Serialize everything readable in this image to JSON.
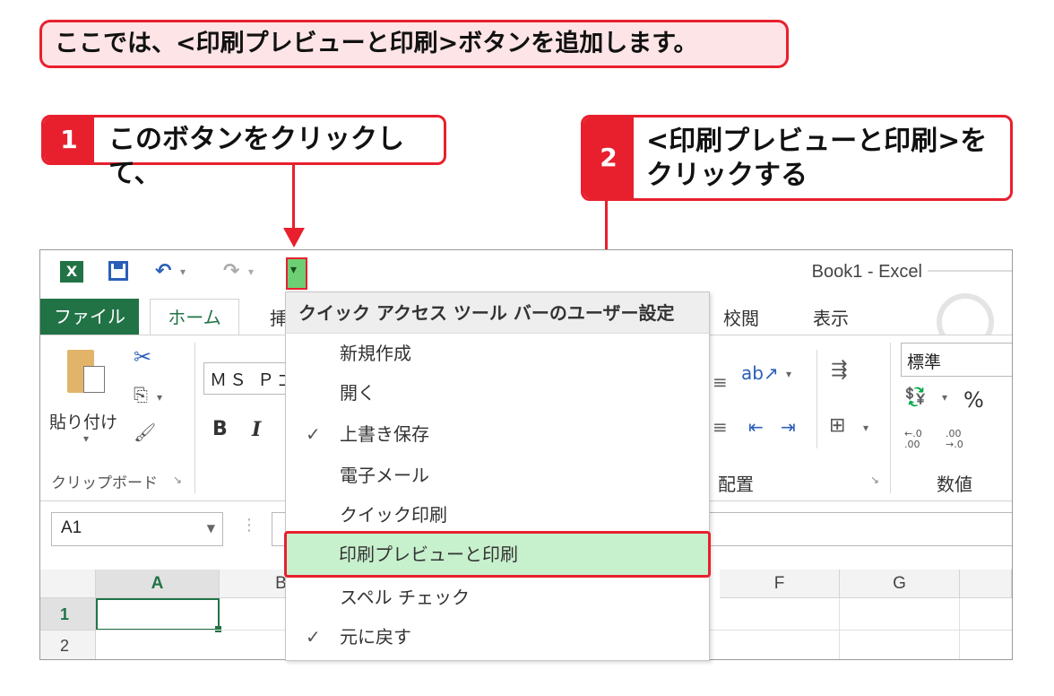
{
  "callout_note": "ここでは、<印刷プレビューと印刷>ボタンを追加します。",
  "step1": {
    "num": "1",
    "text": "このボタンをクリックして、"
  },
  "step2": {
    "num": "2",
    "line1": "<印刷プレビューと印刷>を",
    "line2": "クリックする"
  },
  "window": {
    "title": "Book1 - Excel",
    "qat": {
      "excel_icon": "X",
      "save_icon": "save-icon",
      "undo": "↶",
      "redo": "↷",
      "customize_glyph": "▾"
    },
    "tabs": {
      "file": "ファイル",
      "home": "ホーム",
      "insert_partial": "挿",
      "review": "校閲",
      "view": "表示"
    }
  },
  "ribbon": {
    "paste_label": "貼り付け",
    "clipboard_label": "クリップボード",
    "font_name": "ＭＳ Ｐゴ",
    "bold": "B",
    "italic": "I",
    "alignment_label": "配置",
    "number_format": "標準",
    "number_label": "数値",
    "percent": "%",
    "dec_inc": "←.0 .00",
    "dec_dec": ".00 →.0"
  },
  "formula_bar": {
    "name_box": "A1"
  },
  "grid": {
    "columns": [
      "A",
      "B",
      "F",
      "G"
    ],
    "rows": [
      "1",
      "2"
    ]
  },
  "menu": {
    "header": "クイック アクセス ツール バーのユーザー設定",
    "items": [
      {
        "label": "新規作成",
        "checked": ""
      },
      {
        "label": "開く",
        "checked": ""
      },
      {
        "label": "上書き保存",
        "checked": "✓"
      },
      {
        "label": "電子メール",
        "checked": ""
      },
      {
        "label": "クイック印刷",
        "checked": ""
      },
      {
        "label": "印刷プレビューと印刷",
        "checked": ""
      },
      {
        "label": "スペル チェック",
        "checked": ""
      },
      {
        "label": "元に戻す",
        "checked": "✓"
      }
    ]
  },
  "colors": {
    "accent_red": "#e8202e",
    "excel_green": "#217346",
    "highlight": "#c7f0cd"
  }
}
